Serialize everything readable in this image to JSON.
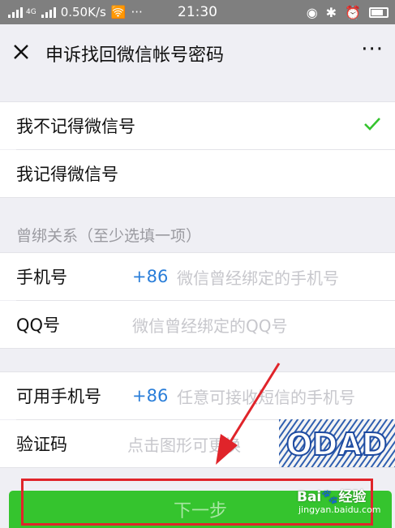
{
  "status_bar": {
    "network_label": "4G",
    "speed": "0.50K/s",
    "more": "···",
    "time": "21:30"
  },
  "nav": {
    "title": "申诉找回微信帐号密码",
    "more": "···"
  },
  "choice": {
    "options": [
      {
        "label": "我不记得微信号",
        "checked": true
      },
      {
        "label": "我记得微信号",
        "checked": false
      }
    ]
  },
  "binding": {
    "section_label": "曾绑关系（至少选填一项）",
    "phone": {
      "label": "手机号",
      "prefix": "+86",
      "placeholder": "微信曾经绑定的手机号"
    },
    "qq": {
      "label": "QQ号",
      "placeholder": "微信曾经绑定的QQ号"
    }
  },
  "contact": {
    "phone": {
      "label": "可用手机号",
      "prefix": "+86",
      "placeholder": "任意可接收短信的手机号"
    },
    "code": {
      "label": "验证码",
      "placeholder": "点击图形可更换",
      "captcha_text": "ODAD"
    }
  },
  "next_button": {
    "label": "下一步"
  },
  "watermark": {
    "brand": "Bai",
    "brand_tail": "经验",
    "url": "jingyan.baidu.com"
  },
  "colors": {
    "accent_green": "#35c42e",
    "link_blue": "#2a7ed9",
    "annotation_red": "#e0242a"
  }
}
